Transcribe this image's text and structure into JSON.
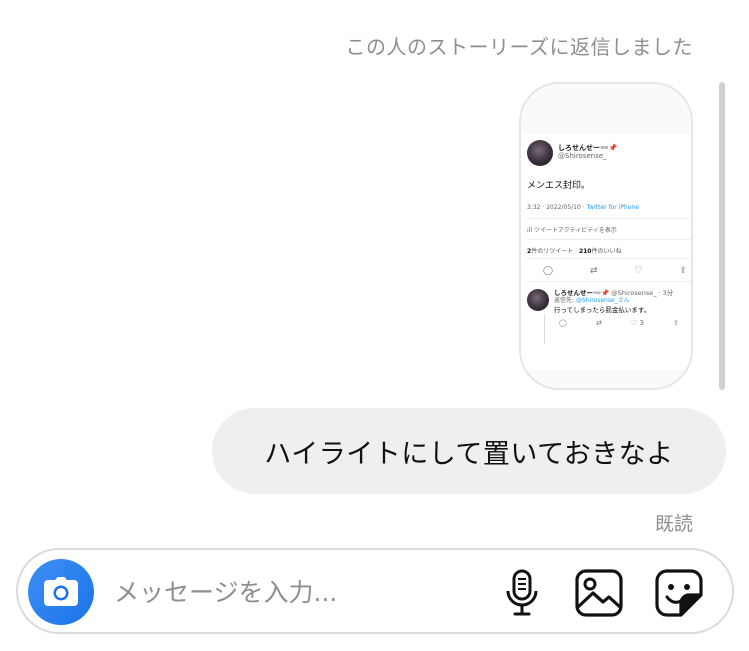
{
  "thread": {
    "story_reply_caption": "この人のストーリーズに返信しました",
    "message_text": "ハイライトにして置いておきなよ",
    "read_receipt": "既読"
  },
  "story_preview": {
    "author_name": "しろせんせー👓📌",
    "author_handle": "@Shirosense_",
    "tweet_text": "メンエス封印。",
    "tweet_time": "3:32 · 2022/05/10 · ",
    "tweet_client": "Twitter for iPhone",
    "activity_label": "ツイートアクティビティを表示",
    "retweets_count": "2",
    "retweets_label": "件のリツイート",
    "likes_count": "210",
    "likes_label": "件のいいね",
    "reply": {
      "author_name": "しろせんせー👓📌",
      "meta": "@Shirosense_ · 3分",
      "reply_to_label": "返信先: ",
      "reply_to_handle": "@Shirosense_さん",
      "text": "行ってしまったら罰金払います。",
      "like_count": "3"
    }
  },
  "composer": {
    "placeholder": "メッセージを入力..."
  },
  "icons": {
    "camera": "camera-icon",
    "mic": "microphone-icon",
    "gallery": "image-icon",
    "sticker": "sticker-icon"
  },
  "colors": {
    "accent": "#1a73e8",
    "bubble": "#efefef",
    "muted_text": "#8e8e8e",
    "link": "#1d9bf0"
  }
}
